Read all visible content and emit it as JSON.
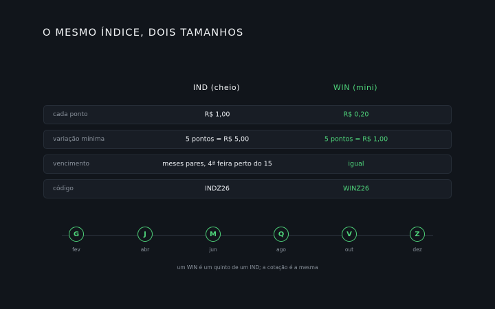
{
  "title": "O MESMO ÍNDICE, DOIS TAMANHOS",
  "columns": {
    "ind": "IND (cheio)",
    "win": "WIN (mini)"
  },
  "rows": [
    {
      "label": "cada ponto",
      "ind": "R$ 1,00",
      "win": "R$ 0,20"
    },
    {
      "label": "variação mínima",
      "ind": "5 pontos = R$ 5,00",
      "win": "5 pontos = R$ 1,00"
    },
    {
      "label": "vencimento",
      "ind": "meses pares, 4ª feira perto do 15",
      "win": "igual"
    },
    {
      "label": "código",
      "ind": "INDZ26",
      "win": "WINZ26"
    }
  ],
  "months": [
    {
      "code": "G",
      "name": "fev"
    },
    {
      "code": "J",
      "name": "abr"
    },
    {
      "code": "M",
      "name": "jun"
    },
    {
      "code": "Q",
      "name": "ago"
    },
    {
      "code": "V",
      "name": "out"
    },
    {
      "code": "Z",
      "name": "dez"
    }
  ],
  "footnote": "um WIN é um quinto de um IND; a cotação é a mesma",
  "colors": {
    "background": "#11151b",
    "accent": "#4ed37a",
    "row_bg": "#181d25"
  }
}
